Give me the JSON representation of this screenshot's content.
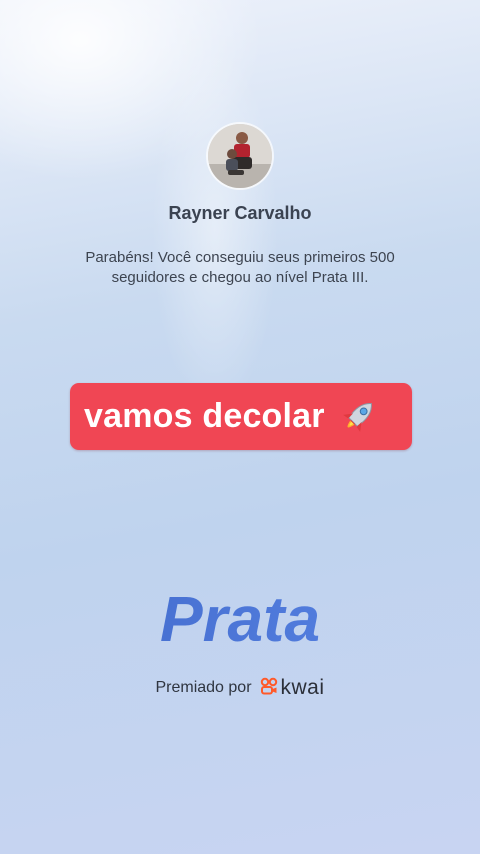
{
  "profile": {
    "name": "Rayner Carvalho",
    "message": "Parabéns! Você conseguiu seus primeiros 500 seguidores e chegou ao nível Prata III."
  },
  "banner": {
    "text": "vamos decolar",
    "icon": "rocket-icon",
    "color": "#f04654"
  },
  "tier": {
    "name": "Prata"
  },
  "award": {
    "label": "Premiado por",
    "brand": "kwai",
    "brand_icon": "kwai-logo-icon",
    "brand_color": "#ff5a2a"
  }
}
